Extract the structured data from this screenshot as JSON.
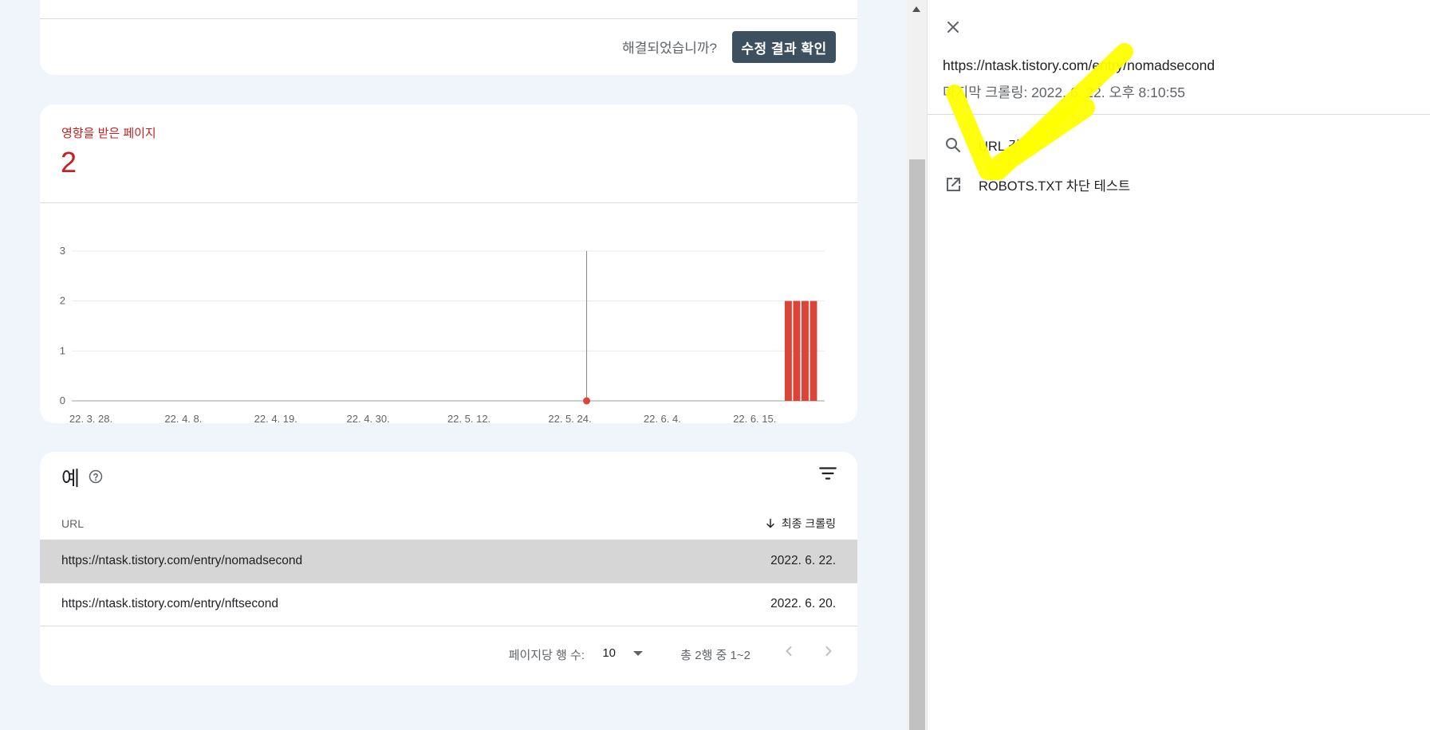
{
  "top_card": {
    "question": "해결되었습니까?",
    "validate_button": "수정 결과 확인"
  },
  "affected_card": {
    "label": "영향을 받은 페이지",
    "count": "2"
  },
  "chart_data": {
    "type": "bar",
    "y_ticks": [
      "0",
      "1",
      "2",
      "3"
    ],
    "ylim": [
      0,
      3
    ],
    "x_tick_labels": [
      "22. 3. 28.",
      "22. 4. 8.",
      "22. 4. 19.",
      "22. 4. 30.",
      "22. 5. 12.",
      "22. 5. 24.",
      "22. 6. 4.",
      "22. 6. 15."
    ],
    "x_range": [
      "22. 3. 28.",
      "22. 6. 22."
    ],
    "bars": [
      {
        "date": "22. 6. 19.",
        "value": 2
      },
      {
        "date": "22. 6. 20.",
        "value": 2
      },
      {
        "date": "22. 6. 21.",
        "value": 2
      },
      {
        "date": "22. 6. 22.",
        "value": 2
      }
    ],
    "marker": {
      "date": "22. 5. 26.",
      "value": 0
    },
    "bar_color": "#db4437",
    "grid": true
  },
  "examples_card": {
    "title": "예",
    "col_url": "URL",
    "col_last_crawl": "최종 크롤링",
    "rows": [
      {
        "url": "https://ntask.tistory.com/entry/nomadsecond",
        "date": "2022. 6. 22.",
        "selected": true
      },
      {
        "url": "https://ntask.tistory.com/entry/nftsecond",
        "date": "2022. 6. 20.",
        "selected": false
      }
    ],
    "pager": {
      "rows_per_page_label": "페이지당 행 수:",
      "rows_per_page": "10",
      "range": "총 2행 중 1~2"
    }
  },
  "side_panel": {
    "url": "https://ntask.tistory.com/entry/nomadsecond",
    "last_crawl": "마지막 크롤링: 2022. 6. 22. 오후 8:10:55",
    "actions": [
      {
        "label": "URL 검사",
        "icon": "search-icon"
      },
      {
        "label": "ROBOTS.TXT 차단 테스트",
        "icon": "open-in-new-icon"
      }
    ]
  },
  "annotation_color": "#ffff00"
}
